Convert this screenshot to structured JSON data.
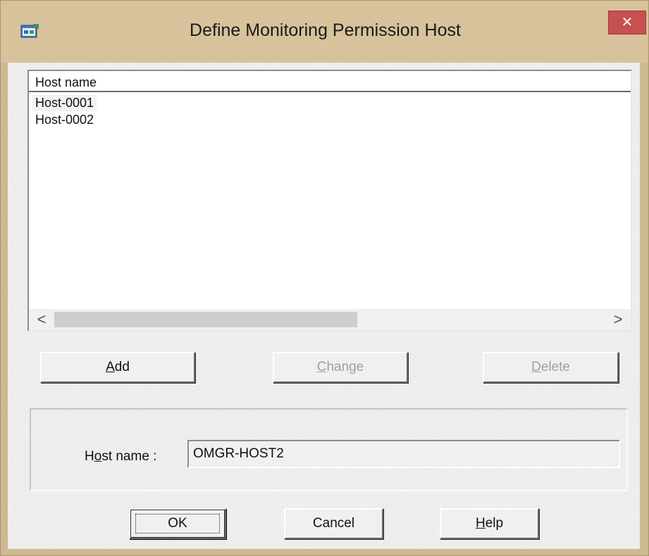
{
  "window": {
    "title": "Define Monitoring Permission Host",
    "close_glyph": "✕",
    "icon": "app-window-icon"
  },
  "list": {
    "column_header": "Host name",
    "rows": [
      "Host-0001",
      "Host-0002"
    ],
    "scroll_left_glyph": "<",
    "scroll_right_glyph": ">"
  },
  "actions": {
    "add": {
      "mnemonic": "A",
      "rest": "dd",
      "enabled": true
    },
    "change": {
      "mnemonic": "C",
      "rest": "hange",
      "enabled": false
    },
    "delete": {
      "mnemonic": "D",
      "rest": "elete",
      "enabled": false
    }
  },
  "host_field": {
    "label_pre": "H",
    "label_mnemonic": "o",
    "label_post": "st name :",
    "value": "OMGR-HOST2"
  },
  "footer": {
    "ok_label": "OK",
    "cancel_label": "Cancel",
    "help": {
      "mnemonic": "H",
      "rest": "elp"
    }
  },
  "colors": {
    "titlebar": "#d7c29b",
    "close_button": "#c75050",
    "dialog_face": "#f0f0f0"
  }
}
